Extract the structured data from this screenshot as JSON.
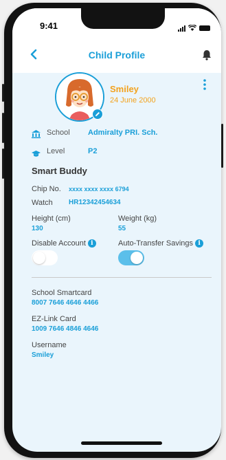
{
  "status_bar": {
    "time": "9:41",
    "icons": [
      "signal-icon",
      "wifi-icon",
      "battery-icon"
    ]
  },
  "header": {
    "title": "Child Profile",
    "back_icon": "chevron-left-icon",
    "bell_icon": "bell-icon"
  },
  "profile": {
    "name": "Smiley",
    "dob": "24 June 2000",
    "menu_icon": "kebab-menu-icon"
  },
  "school": {
    "label": "School",
    "value": "Admiralty PRI. Sch.",
    "icon": "school-icon"
  },
  "level": {
    "label": "Level",
    "value": "P2",
    "icon": "graduation-cap-icon"
  },
  "smart_buddy": {
    "title": "Smart Buddy",
    "chip_label": "Chip No.",
    "chip_value": "xxxx xxxx xxxx 6794",
    "watch_label": "Watch",
    "watch_value": "HR12342454634",
    "height_label": "Height (cm)",
    "height_value": "130",
    "weight_label": "Weight (kg)",
    "weight_value": "55",
    "disable_label": "Disable Account",
    "disable_on": false,
    "auto_label": "Auto-Transfer Savings",
    "auto_on": true
  },
  "cards": {
    "smartcard_label": "School Smartcard",
    "smartcard_value": "8007 7646 4646 4466",
    "ezlink_label": "EZ-Link Card",
    "ezlink_value": "1009 7646 4846 4646",
    "username_label": "Username",
    "username_value": "Smiley"
  },
  "colors": {
    "accent": "#1a9fd8",
    "name": "#f3a21d",
    "background": "#eaf5fc"
  }
}
